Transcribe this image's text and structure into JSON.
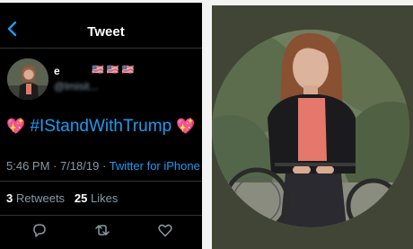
{
  "header": {
    "title": "Tweet"
  },
  "author": {
    "name_visible": "e",
    "flags": "🇺🇸 🇺🇸 🇺🇸",
    "handle_blurred": "@lmisit..."
  },
  "tweet": {
    "emoji_left": "💖",
    "text": "#IStandWithTrump",
    "emoji_right": "💖",
    "time": "5:46 PM",
    "date": "7/18/19",
    "separator": " · ",
    "client": "Twitter for iPhone"
  },
  "stats": {
    "retweets_count": "3",
    "retweets_label": "Retweets",
    "likes_count": "25",
    "likes_label": "Likes"
  },
  "actions": [
    "reply-icon",
    "retweet-icon",
    "like-icon"
  ],
  "colors": {
    "background": "#000000",
    "accent": "#1d9bf0",
    "muted": "#8899a6",
    "heart": "#ff5fa8",
    "photo_frame": "#414535"
  }
}
